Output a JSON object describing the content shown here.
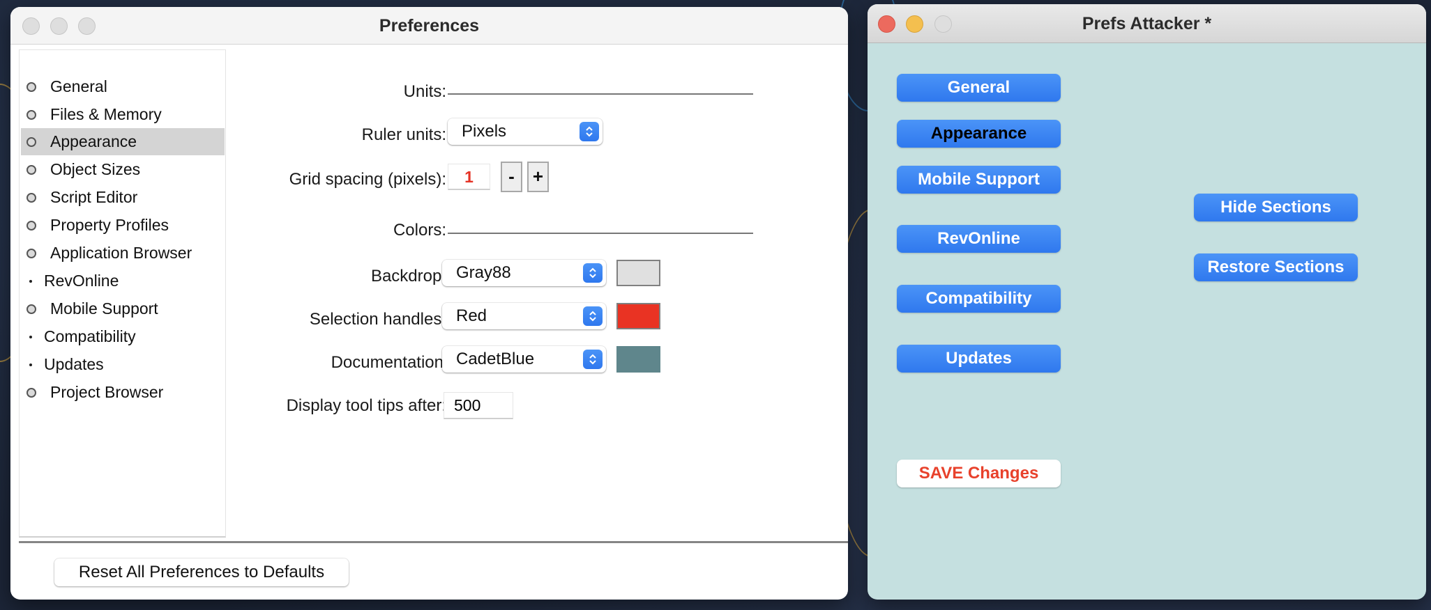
{
  "preferences_window": {
    "title": "Preferences",
    "sidebar": {
      "items": [
        {
          "label": "General",
          "bullet": "circle",
          "selected": false
        },
        {
          "label": "Files & Memory",
          "bullet": "circle",
          "selected": false
        },
        {
          "label": "Appearance",
          "bullet": "circle",
          "selected": true
        },
        {
          "label": "Object Sizes",
          "bullet": "circle",
          "selected": false
        },
        {
          "label": "Script Editor",
          "bullet": "circle",
          "selected": false
        },
        {
          "label": "Property Profiles",
          "bullet": "circle",
          "selected": false
        },
        {
          "label": "Application Browser",
          "bullet": "circle",
          "selected": false
        },
        {
          "label": "RevOnline",
          "bullet": "dot",
          "selected": false
        },
        {
          "label": "Mobile Support",
          "bullet": "circle",
          "selected": false
        },
        {
          "label": "Compatibility",
          "bullet": "dot",
          "selected": false
        },
        {
          "label": "Updates",
          "bullet": "dot",
          "selected": false
        },
        {
          "label": "Project Browser",
          "bullet": "circle",
          "selected": false
        }
      ]
    },
    "units_section": {
      "heading": "Units:",
      "ruler_units_label": "Ruler units:",
      "ruler_units_value": "Pixels",
      "grid_spacing_label": "Grid spacing (pixels):",
      "grid_spacing_value": "1",
      "decrement_label": "-",
      "increment_label": "+"
    },
    "colors_section": {
      "heading": "Colors:",
      "rows": [
        {
          "label": "Backdrop:",
          "value": "Gray88",
          "swatch": "#e0e0e0"
        },
        {
          "label": "Selection handles:",
          "value": "Red",
          "swatch": "#e93323"
        },
        {
          "label": "Documentation",
          "value": "CadetBlue",
          "swatch": "#5f868c"
        }
      ]
    },
    "tooltips": {
      "label": "Display tool tips after:",
      "value": "500"
    },
    "reset_button": "Reset All Preferences to Defaults"
  },
  "attacker_window": {
    "title": "Prefs Attacker *",
    "section_buttons": [
      {
        "label": "General",
        "highlighted": false
      },
      {
        "label": "Appearance",
        "highlighted": true
      },
      {
        "label": "Mobile Support",
        "highlighted": false
      },
      {
        "label": "RevOnline",
        "highlighted": false
      },
      {
        "label": "Compatibility",
        "highlighted": false
      },
      {
        "label": "Updates",
        "highlighted": false
      }
    ],
    "hide_sections": "Hide Sections",
    "restore_sections": "Restore Sections",
    "save_changes": "SAVE Changes"
  },
  "colors": {
    "accent_blue": "#3a83f2",
    "save_red": "#e8412b",
    "attacker_bg": "#c5e0e0"
  }
}
